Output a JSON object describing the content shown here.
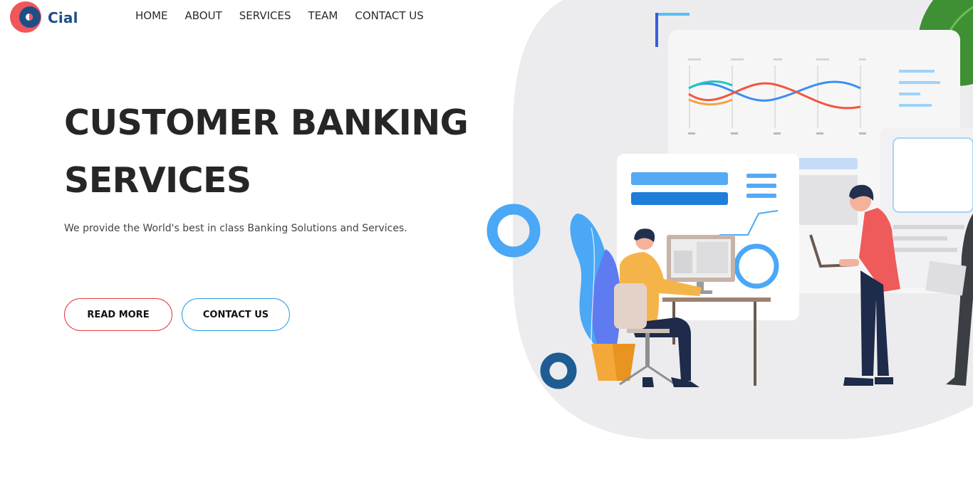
{
  "brand": {
    "name": "Cial",
    "icon": "brand-logo-icon"
  },
  "nav": {
    "items": [
      "HOME",
      "ABOUT",
      "SERVICES",
      "TEAM",
      "CONTACT US"
    ]
  },
  "hero": {
    "title_line1": "CUSTOMER BANKING",
    "title_line2": "SERVICES",
    "subtitle": "We provide the World's best in class Banking Solutions and Services.",
    "read_more": "READ MORE",
    "contact_us": "CONTACT US"
  },
  "colors": {
    "brand_red": "#f0565a",
    "brand_navy": "#1e4e86",
    "accent_blue": "#4aa8f6",
    "button_red_border": "#e2383f",
    "button_blue_border": "#2a9be3"
  }
}
